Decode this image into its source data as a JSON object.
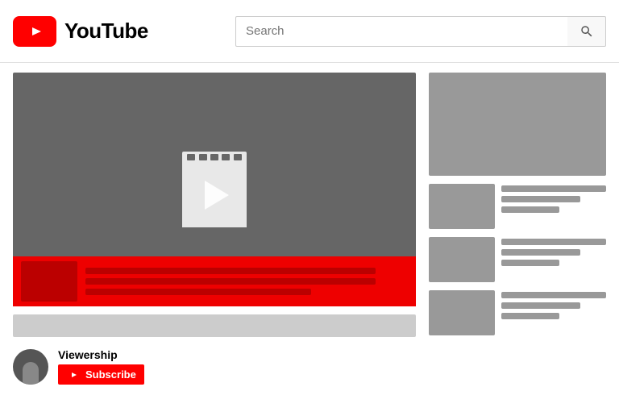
{
  "header": {
    "logo_text": "YouTube",
    "search_placeholder": "Search",
    "search_label": "Search"
  },
  "main": {
    "channel": {
      "name": "Viewership",
      "subscribe_label": "Subscribe"
    },
    "recommended": [
      {
        "id": 1
      },
      {
        "id": 2
      },
      {
        "id": 3
      }
    ]
  }
}
